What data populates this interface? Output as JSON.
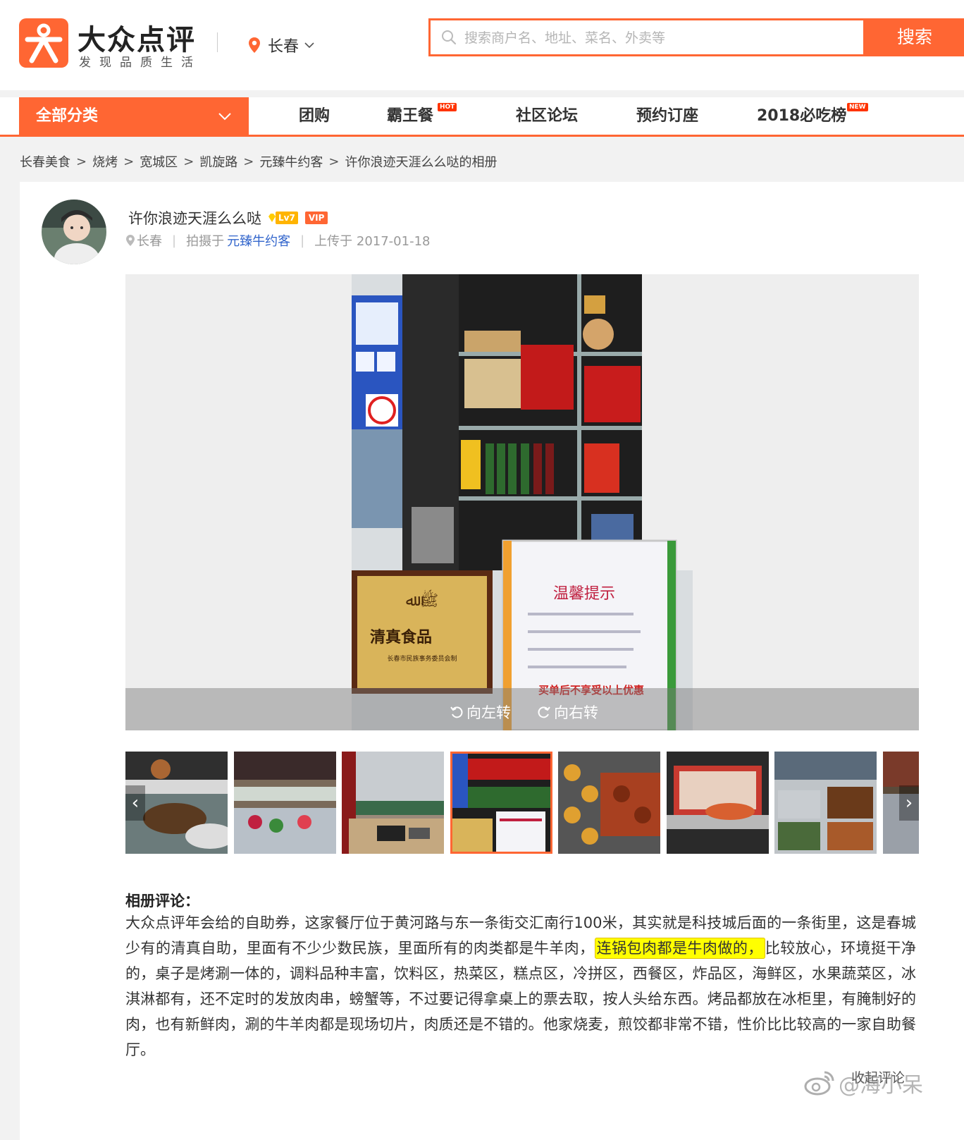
{
  "header": {
    "logo_title": "大众点评",
    "logo_sub": "发现品质生活",
    "city": "长春",
    "search_placeholder": "搜索商户名、地址、菜名、外卖等",
    "search_button": "搜索"
  },
  "nav": {
    "all_categories": "全部分类",
    "items": [
      {
        "label": "团购"
      },
      {
        "label": "霸王餐",
        "badge": "HOT"
      },
      {
        "label": "社区论坛"
      },
      {
        "label": "预约订座"
      },
      {
        "label": "2018必吃榜",
        "badge": "NEW"
      }
    ]
  },
  "breadcrumb": [
    "长春美食",
    "烧烤",
    "宽城区",
    "凯旋路",
    "元臻牛约客",
    "许你浪迹天涯么么哒的相册"
  ],
  "post": {
    "author": "许你浪迹天涯么么哒",
    "level": "Lv7",
    "vip": "VIP",
    "location": "长春",
    "shot_at_label": "拍摄于",
    "shop": "元臻牛约客",
    "uploaded": "上传于 2017-01-18"
  },
  "photo": {
    "rotate_left": "向左转",
    "rotate_right": "向右转",
    "sign_title": "温馨提示",
    "sign_footer": "买单后不享受以上优惠",
    "plaque_text": "清真食品",
    "plaque_sub": "长春市民族事务委员会制"
  },
  "comment": {
    "title": "相册评论：",
    "part1": "大众点评年会给的自助券，这家餐厅位于黄河路与东一条街交汇南行100米，其实就是科技城后面的一条街里，这是春城少有的清真自助，里面有不少少数民族，里面所有的肉类都是牛羊肉，",
    "highlight": "连锅包肉都是牛肉做的，",
    "part2": "比较放心，环境挺干净的，桌子是烤涮一体的，调料品种丰富，饮料区，热菜区，糕点区，冷拼区，西餐区，炸品区，海鲜区，水果蔬菜区，冰淇淋都有，还不定时的发放肉串，螃蟹等，不过要记得拿桌上的票去取，按人头给东西。烤品都放在冰柜里，有腌制好的肉，也有新鲜肉，涮的牛羊肉都是现场切片，肉质还是不错的。他家烧麦，煎饺都非常不错，性价比比较高的一家自助餐厅。",
    "reply": "收起评论"
  },
  "watermark": "@海小呆",
  "colors": {
    "brand": "#ff6633",
    "link": "#3366cc",
    "highlight": "#ffff00"
  }
}
